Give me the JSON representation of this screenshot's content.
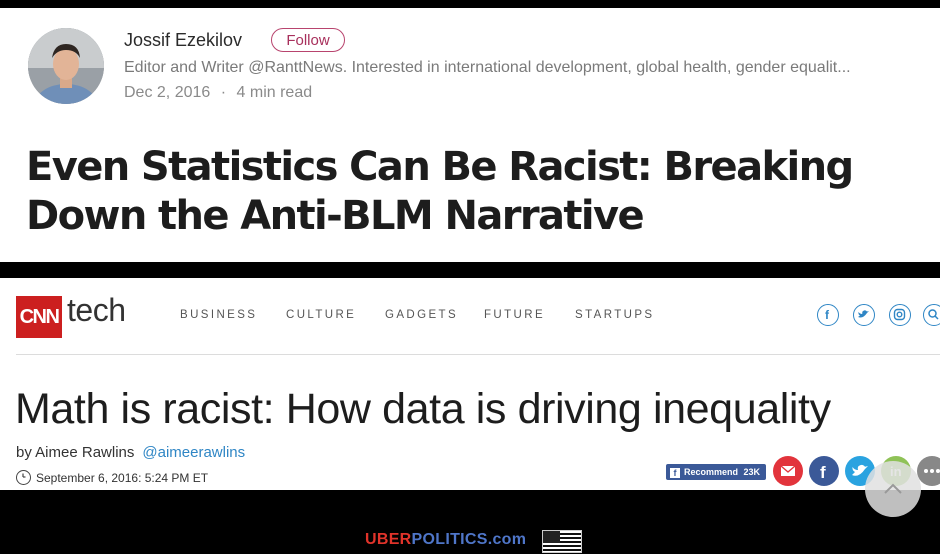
{
  "medium": {
    "author_name": "Jossif Ezekilov",
    "follow_label": "Follow",
    "author_bio": "Editor and Writer @RanttNews. Interested in international development, global health, gender equalit...",
    "post_date": "Dec 2, 2016",
    "separator": "·",
    "read_time": "4 min read",
    "title": "Even Statistics Can Be Racist: Breaking Down the Anti-BLM Narrative"
  },
  "cnn": {
    "logo_text": "CNN",
    "brand_suffix": "tech",
    "nav": [
      "BUSINESS",
      "CULTURE",
      "GADGETS",
      "FUTURE",
      "STARTUPS"
    ],
    "social_icons": [
      "facebook-icon",
      "twitter-icon",
      "instagram-icon",
      "search-icon"
    ],
    "title": "Math is racist: How data is driving inequality",
    "byline_prefix": "by Aimee Rawlins",
    "twitter_handle": "@aimeerawlins",
    "dateline": "September 6, 2016: 5:24 PM ET",
    "recommend_label": "Recommend",
    "recommend_count": "23K",
    "share_icons": [
      "email-icon",
      "facebook-icon",
      "twitter-icon",
      "linkedin-icon",
      "more-icon"
    ]
  },
  "footer": {
    "uber": "UBER",
    "politics": "POLITICS.com"
  },
  "colors": {
    "follow_accent": "#b8446e",
    "cnn_red": "#cc1f1f",
    "link_blue": "#2f86c5",
    "facebook_blue": "#3b5998"
  }
}
